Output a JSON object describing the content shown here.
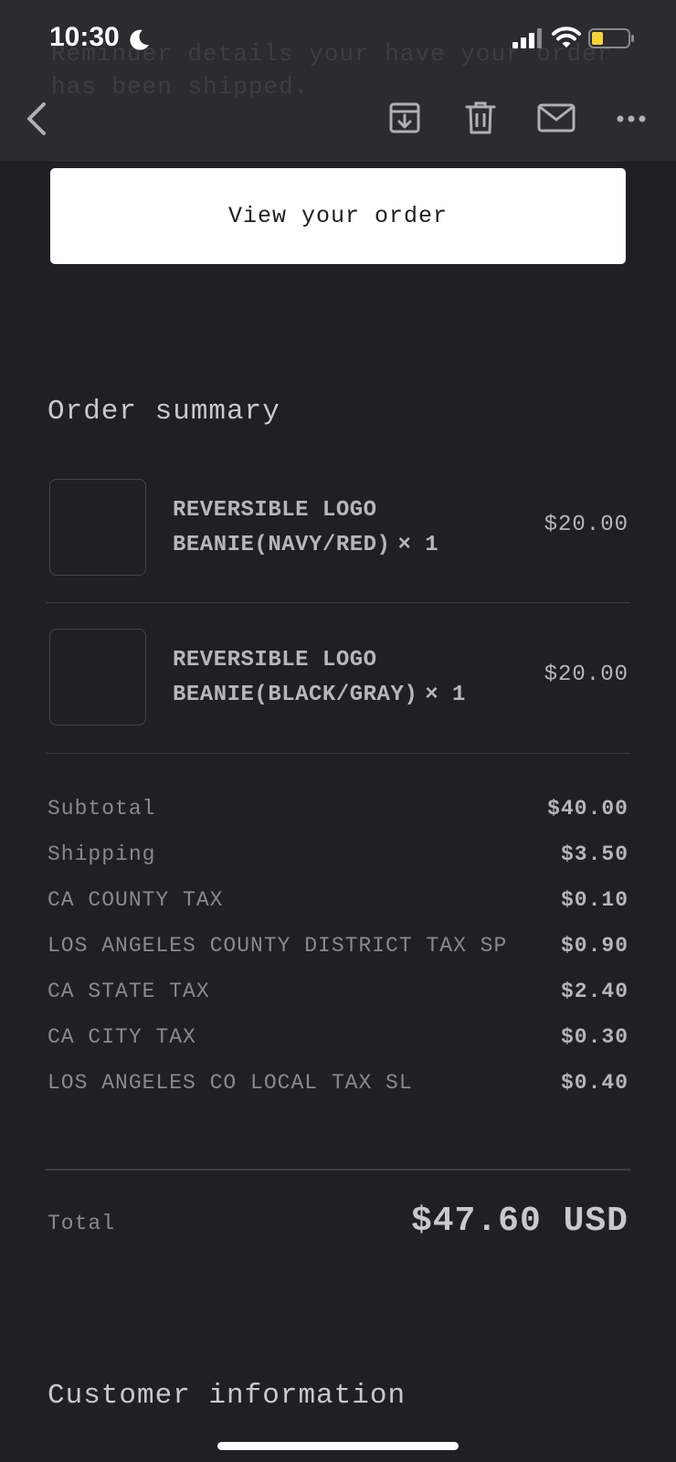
{
  "status_bar": {
    "time": "10:30",
    "icons": [
      "moon-icon",
      "cellular-signal-icon",
      "wifi-icon",
      "battery-icon"
    ]
  },
  "toolbar": {
    "icons": [
      "back-chevron-icon",
      "archive-icon",
      "trash-icon",
      "mail-icon",
      "more-icon"
    ]
  },
  "email": {
    "view_order_label": "View your order",
    "order_summary_title": "Order summary",
    "items": [
      {
        "name": "REVERSIBLE LOGO BEANIE(NAVY/RED)",
        "qty": "× 1",
        "price": "$20.00"
      },
      {
        "name": "REVERSIBLE LOGO BEANIE(BLACK/GRAY)",
        "qty": "× 1",
        "price": "$20.00"
      }
    ],
    "costs": [
      {
        "label": "Subtotal",
        "value": "$40.00"
      },
      {
        "label": "Shipping",
        "value": "$3.50"
      },
      {
        "label": "CA COUNTY TAX",
        "value": "$0.10"
      },
      {
        "label": "LOS ANGELES COUNTY DISTRICT TAX SP",
        "value": "$0.90"
      },
      {
        "label": "CA STATE TAX",
        "value": "$2.40"
      },
      {
        "label": "CA CITY TAX",
        "value": "$0.30"
      },
      {
        "label": "LOS ANGELES CO LOCAL TAX SL",
        "value": "$0.40"
      }
    ],
    "total_label": "Total",
    "total_value": "$47.60 USD",
    "customer_info_title": "Customer information"
  },
  "colors": {
    "background": "#202024",
    "header": "#2c2c30",
    "button_bg": "#ffffff",
    "text_primary": "#c9c9cc",
    "text_secondary": "#8a8a8e",
    "battery_fill": "#f5d33a"
  }
}
